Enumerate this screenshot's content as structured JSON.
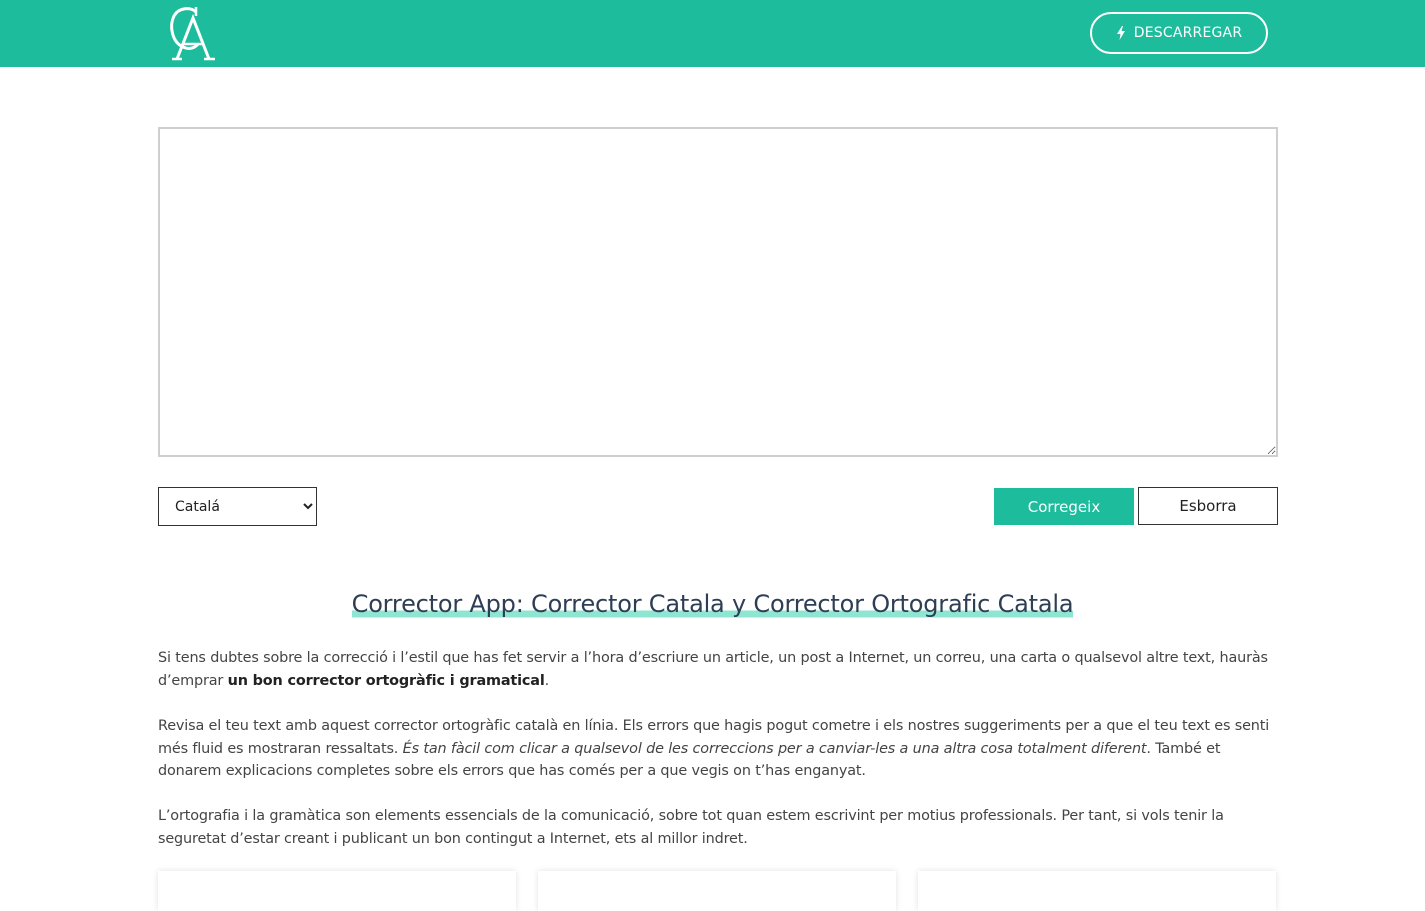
{
  "header": {
    "logo_letters": "CA",
    "download_label": "DESCARREGAR",
    "download_icon": "bolt-icon",
    "brand_color": "#1dbc9c"
  },
  "editor": {
    "value": "",
    "placeholder": ""
  },
  "controls": {
    "language_selected": "Catalá",
    "correct_label": "Corregeix",
    "clear_label": "Esborra"
  },
  "content": {
    "title": "Corrector App: Corrector Catala y Corrector Ortografic Catala",
    "p1_text": "Si tens dubtes sobre la correcció i l’estil que has fet servir a l’hora d’escriure un article, un post a Internet, un correu, una carta o qualsevol altre text, hauràs d’emprar ",
    "p1_bold": "un bon corrector ortogràfic i gramatical",
    "p1_end": ".",
    "p2_text": "Revisa el teu text amb aquest corrector ortogràfic català en línia. Els errors que hagis pogut cometre i els nostres suggeriments per a que el teu text es senti més fluid es mostraran ressaltats. ",
    "p2_italic": "És tan fàcil com clicar a qualsevol de les correccions per a canviar-les a una altra cosa totalment diferent",
    "p2_end": ". També et donarem explicacions completes sobre els errors que has comés per a que vegis on t’has enganyat.",
    "p3_text": "L’ortografia i la gramàtica son elements essencials de la comunicació, sobre tot quan estem escrivint per motius professionals. Per tant, si vols tenir la seguretat d’estar creant i publicant un bon contingut a Internet, ets al millor indret."
  }
}
